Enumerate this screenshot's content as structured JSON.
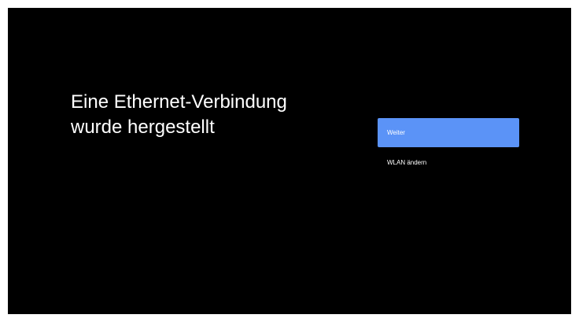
{
  "screen": {
    "title_line1": "Eine Ethernet-Verbindung",
    "title_line2": "wurde hergestellt"
  },
  "actions": {
    "continue_label": "Weiter",
    "change_wlan_label": "WLAN ändern"
  },
  "colors": {
    "background": "#000000",
    "accent": "#5b93f7",
    "text": "#ffffff"
  }
}
